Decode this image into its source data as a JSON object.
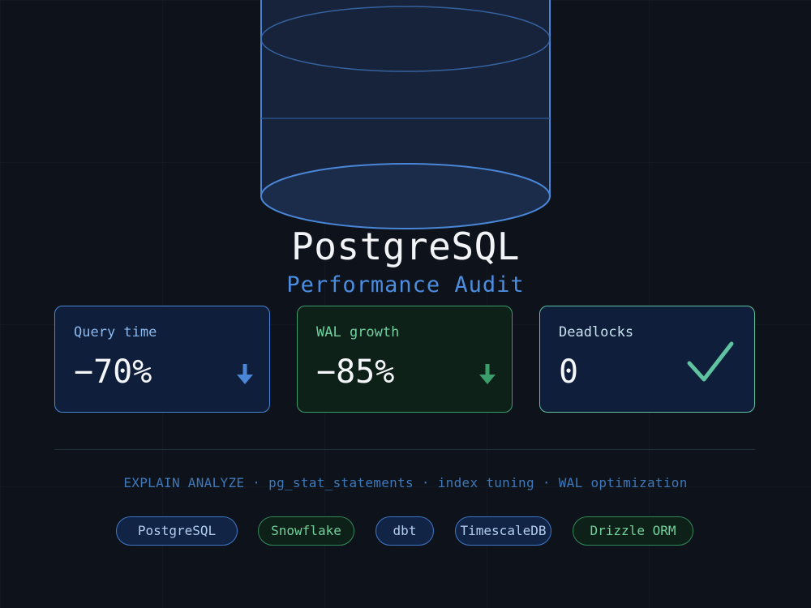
{
  "hero": {
    "title": "PostgreSQL",
    "subtitle": "Performance Audit",
    "icon": "database-cylinder-icon"
  },
  "metrics": [
    {
      "label": "Query time",
      "value": "−70%",
      "trend_icon": "arrow-down-icon",
      "accent": "#4a86d6"
    },
    {
      "label": "WAL growth",
      "value": "−85%",
      "trend_icon": "arrow-down-icon",
      "accent": "#3b9e6a"
    },
    {
      "label": "Deadlocks",
      "value": "0",
      "trend_icon": "checkmark-icon",
      "accent": "#5fc2a0"
    }
  ],
  "techline": "EXPLAIN ANALYZE · pg_stat_statements · index tuning · WAL optimization",
  "tags": [
    {
      "label": "PostgreSQL",
      "color": "blue"
    },
    {
      "label": "Snowflake",
      "color": "green"
    },
    {
      "label": "dbt",
      "color": "blue"
    },
    {
      "label": "TimescaleDB",
      "color": "blue"
    },
    {
      "label": "Drizzle ORM",
      "color": "green"
    }
  ],
  "colors": {
    "background": "#0d121b",
    "blue": "#4a86d6",
    "green": "#3b9e6a",
    "teal": "#5fc2a0"
  }
}
